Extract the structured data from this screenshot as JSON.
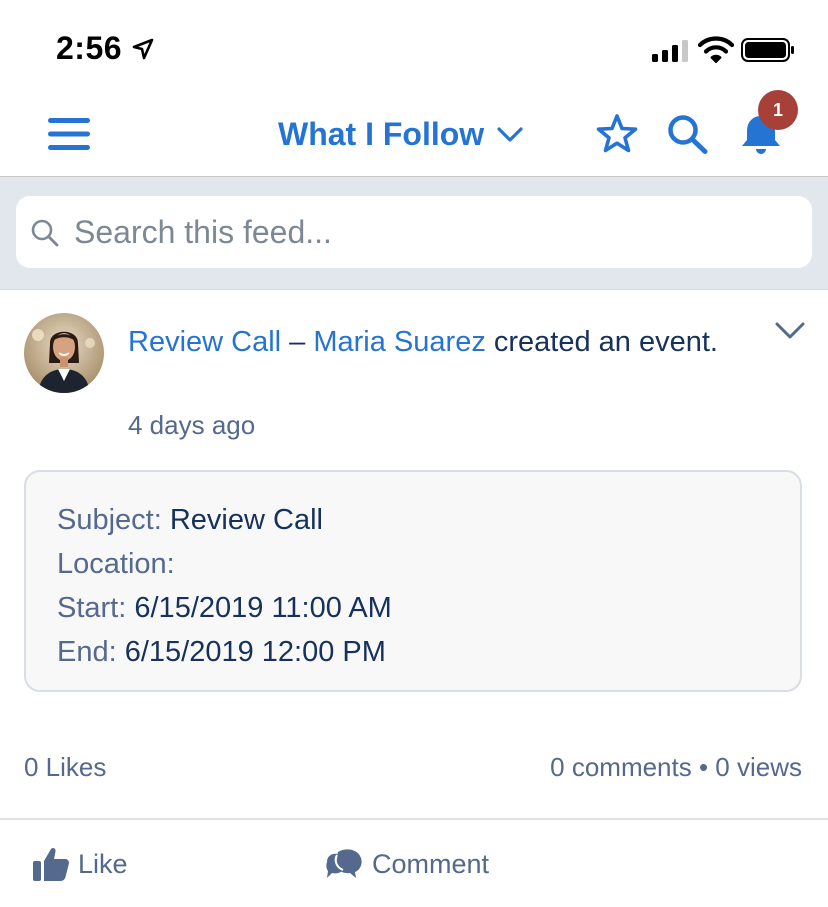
{
  "status_bar": {
    "time": "2:56"
  },
  "nav": {
    "title": "What I Follow",
    "notification_count": "1",
    "accent_color": "#2574d4",
    "badge_color": "#a8403a"
  },
  "search": {
    "placeholder": "Search this feed..."
  },
  "post": {
    "record_link": "Review Call",
    "separator": " – ",
    "author_link": "Maria Suarez",
    "action_text": " created an event.",
    "timestamp": "4 days ago",
    "event": {
      "subject_label": "Subject:",
      "subject_value": "Review Call",
      "location_label": "Location:",
      "location_value": "",
      "start_label": "Start:",
      "start_value": "6/15/2019 11:00 AM",
      "end_label": "End:",
      "end_value": "6/15/2019 12:00 PM"
    },
    "likes": "0 Likes",
    "stats": "0 comments • 0 views"
  },
  "actions": {
    "like_label": "Like",
    "comment_label": "Comment"
  },
  "icons": {
    "menu": "hamburger-icon",
    "dropdown": "chevron-down-icon",
    "favorite": "star-icon",
    "search": "search-icon",
    "notifications": "bell-icon",
    "like": "thumbs-up-icon",
    "comment": "comment-icon"
  }
}
